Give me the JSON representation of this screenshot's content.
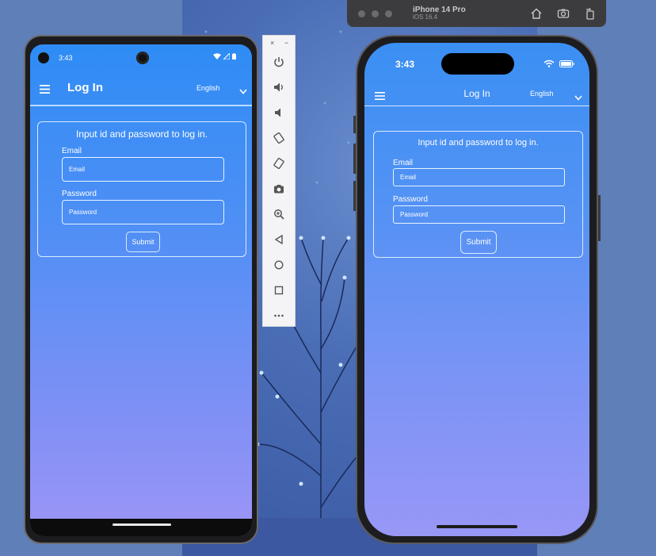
{
  "simulator": {
    "device_name": "iPhone 14 Pro",
    "os_version": "iOS 16.4",
    "actions": [
      "home-icon",
      "screenshot-icon",
      "rotate-icon"
    ]
  },
  "android": {
    "status": {
      "time": "3:43"
    },
    "appbar": {
      "title": "Log In",
      "language": "English"
    },
    "form": {
      "instruction": "Input id and password to log in.",
      "email_label": "Email",
      "email_placeholder": "Email",
      "password_label": "Password",
      "password_placeholder": "Password",
      "submit_label": "Submit"
    }
  },
  "emulator_toolbar": {
    "close": "×",
    "minimize": "−",
    "tools": [
      "power-icon",
      "volume-up-icon",
      "volume-down-icon",
      "rotate-left-icon",
      "rotate-right-icon",
      "camera-icon",
      "zoom-icon",
      "back-icon",
      "home-icon",
      "overview-icon",
      "more-icon"
    ]
  },
  "iphone": {
    "status": {
      "time": "3:43"
    },
    "appbar": {
      "title": "Log In",
      "language": "English"
    },
    "form": {
      "instruction": "Input id and password to log in.",
      "email_label": "Email",
      "email_placeholder": "Email",
      "password_label": "Password",
      "password_placeholder": "Password",
      "submit_label": "Submit"
    }
  },
  "colors": {
    "desktop": "#5f7fb8",
    "app_gradient_top": "#2f8cf5",
    "app_gradient_bottom": "#9d95f6",
    "sim_titlebar": "#3c3c3e"
  }
}
